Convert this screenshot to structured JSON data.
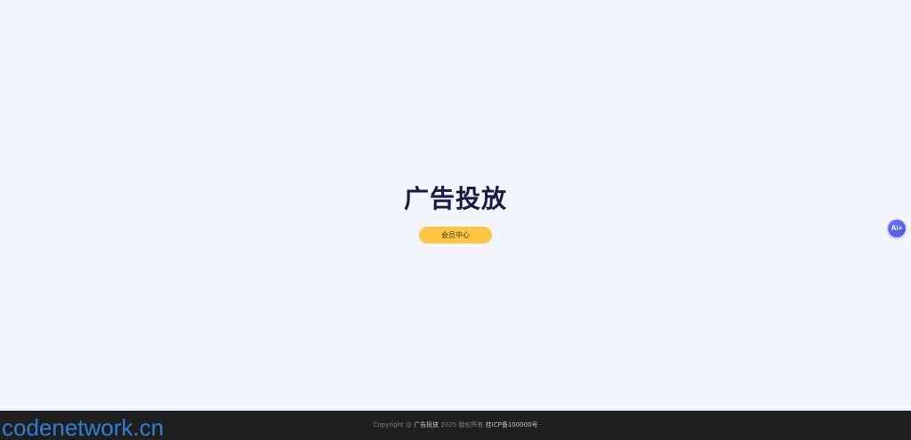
{
  "hero": {
    "title": "广告投放",
    "member_button_label": "会员中心"
  },
  "ai_fab": {
    "label": "Ai+",
    "color": "#5b61f2"
  },
  "footer": {
    "copyright_prefix": "Copyright @",
    "site_name": "广告投放",
    "year_rights": "2025 版权所有",
    "icp": "桂ICP备100000号"
  },
  "watermark": {
    "text": "codenetwork.cn"
  },
  "colors": {
    "page_background": "#f2f5fc",
    "title": "#1b1846",
    "button": "#fdc540",
    "footer_background": "#1f1f1f",
    "watermark": "#2f7fd6"
  }
}
